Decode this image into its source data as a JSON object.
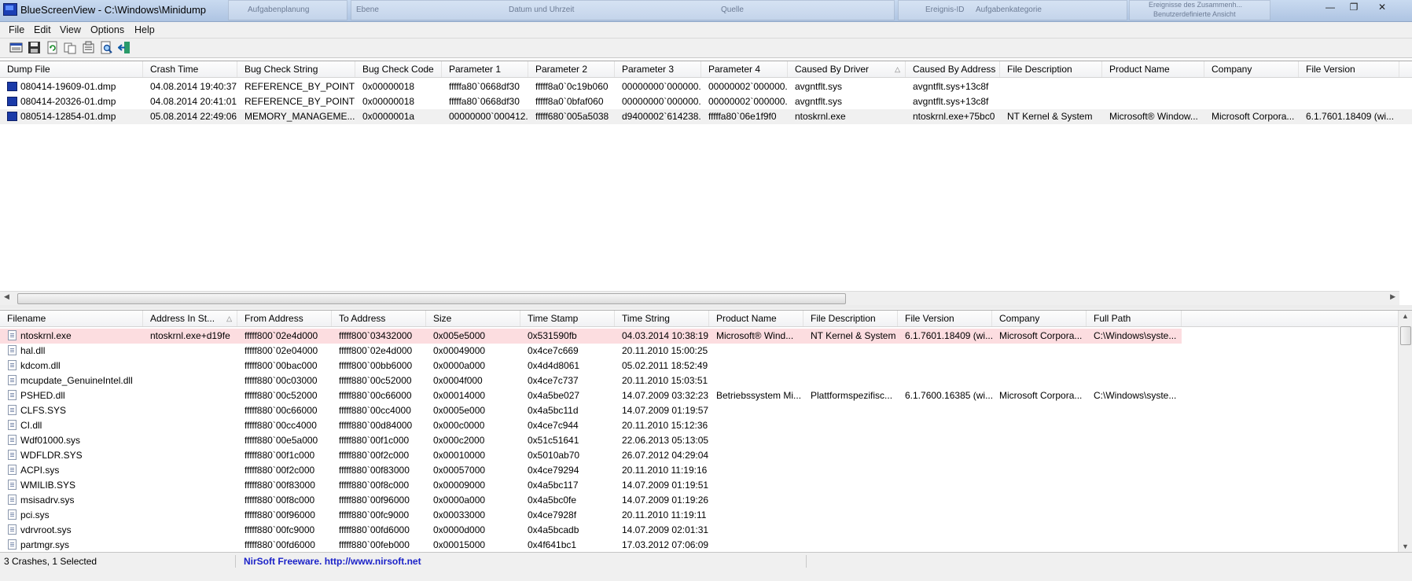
{
  "window": {
    "title": "BlueScreenView  -  C:\\Windows\\Minidump",
    "background_ghosts": [
      "Aufgabenplanung",
      "Ebene",
      "Datum und Uhrzeit",
      "Quelle",
      "Ereignis-ID",
      "Aufgabenkategorie",
      "Ereignisse des Zusammenh...",
      "Benutzerdefinierte Ansicht"
    ]
  },
  "menu": {
    "items": [
      "File",
      "Edit",
      "View",
      "Options",
      "Help"
    ]
  },
  "toolbar": {
    "buttons": [
      "properties-icon",
      "save-icon",
      "refresh-icon",
      "copy-icon",
      "options-icon",
      "find-icon",
      "exit-icon"
    ]
  },
  "crash_list": {
    "columns": [
      "Dump File",
      "Crash Time",
      "Bug Check String",
      "Bug Check Code",
      "Parameter 1",
      "Parameter 2",
      "Parameter 3",
      "Parameter 4",
      "Caused By Driver",
      "Caused By Address",
      "File Description",
      "Product Name",
      "Company",
      "File Version"
    ],
    "rows": [
      [
        "080414-19609-01.dmp",
        "04.08.2014 19:40:37",
        "REFERENCE_BY_POINTER",
        "0x00000018",
        "fffffa80`0668df30",
        "fffff8a0`0c19b060",
        "00000000`000000...",
        "00000002`000000...",
        "avgntflt.sys",
        "avgntflt.sys+13c8f",
        "",
        "",
        "",
        ""
      ],
      [
        "080414-20326-01.dmp",
        "04.08.2014 20:41:01",
        "REFERENCE_BY_POINTER",
        "0x00000018",
        "fffffa80`0668df30",
        "fffff8a0`0bfaf060",
        "00000000`000000...",
        "00000002`000000...",
        "avgntflt.sys",
        "avgntflt.sys+13c8f",
        "",
        "",
        "",
        ""
      ],
      [
        "080514-12854-01.dmp",
        "05.08.2014 22:49:06",
        "MEMORY_MANAGEME...",
        "0x0000001a",
        "00000000`000412...",
        "fffff680`005a5038",
        "d9400002`614238...",
        "fffffa80`06e1f9f0",
        "ntoskrnl.exe",
        "ntoskrnl.exe+75bc0",
        "NT Kernel & System",
        "Microsoft® Window...",
        "Microsoft Corpora...",
        "6.1.7601.18409 (wi..."
      ]
    ]
  },
  "module_list": {
    "columns": [
      "Filename",
      "Address In St...",
      "From Address",
      "To Address",
      "Size",
      "Time Stamp",
      "Time String",
      "Product Name",
      "File Description",
      "File Version",
      "Company",
      "Full Path"
    ],
    "rows": [
      [
        "ntoskrnl.exe",
        "ntoskrnl.exe+d19fe",
        "fffff800`02e4d000",
        "fffff800`03432000",
        "0x005e5000",
        "0x531590fb",
        "04.03.2014 10:38:19",
        "Microsoft® Wind...",
        "NT Kernel & System",
        "6.1.7601.18409 (wi...",
        "Microsoft Corpora...",
        "C:\\Windows\\syste..."
      ],
      [
        "hal.dll",
        "",
        "fffff800`02e04000",
        "fffff800`02e4d000",
        "0x00049000",
        "0x4ce7c669",
        "20.11.2010 15:00:25",
        "",
        "",
        "",
        "",
        ""
      ],
      [
        "kdcom.dll",
        "",
        "fffff800`00bac000",
        "fffff800`00bb6000",
        "0x0000a000",
        "0x4d4d8061",
        "05.02.2011 18:52:49",
        "",
        "",
        "",
        "",
        ""
      ],
      [
        "mcupdate_GenuineIntel.dll",
        "",
        "fffff880`00c03000",
        "fffff880`00c52000",
        "0x0004f000",
        "0x4ce7c737",
        "20.11.2010 15:03:51",
        "",
        "",
        "",
        "",
        ""
      ],
      [
        "PSHED.dll",
        "",
        "fffff880`00c52000",
        "fffff880`00c66000",
        "0x00014000",
        "0x4a5be027",
        "14.07.2009 03:32:23",
        "Betriebssystem Mi...",
        "Plattformspezifisc...",
        "6.1.7600.16385 (wi...",
        "Microsoft Corpora...",
        "C:\\Windows\\syste..."
      ],
      [
        "CLFS.SYS",
        "",
        "fffff880`00c66000",
        "fffff880`00cc4000",
        "0x0005e000",
        "0x4a5bc11d",
        "14.07.2009 01:19:57",
        "",
        "",
        "",
        "",
        ""
      ],
      [
        "CI.dll",
        "",
        "fffff880`00cc4000",
        "fffff880`00d84000",
        "0x000c0000",
        "0x4ce7c944",
        "20.11.2010 15:12:36",
        "",
        "",
        "",
        "",
        ""
      ],
      [
        "Wdf01000.sys",
        "",
        "fffff880`00e5a000",
        "fffff880`00f1c000",
        "0x000c2000",
        "0x51c51641",
        "22.06.2013 05:13:05",
        "",
        "",
        "",
        "",
        ""
      ],
      [
        "WDFLDR.SYS",
        "",
        "fffff880`00f1c000",
        "fffff880`00f2c000",
        "0x00010000",
        "0x5010ab70",
        "26.07.2012 04:29:04",
        "",
        "",
        "",
        "",
        ""
      ],
      [
        "ACPI.sys",
        "",
        "fffff880`00f2c000",
        "fffff880`00f83000",
        "0x00057000",
        "0x4ce79294",
        "20.11.2010 11:19:16",
        "",
        "",
        "",
        "",
        ""
      ],
      [
        "WMILIB.SYS",
        "",
        "fffff880`00f83000",
        "fffff880`00f8c000",
        "0x00009000",
        "0x4a5bc117",
        "14.07.2009 01:19:51",
        "",
        "",
        "",
        "",
        ""
      ],
      [
        "msisadrv.sys",
        "",
        "fffff880`00f8c000",
        "fffff880`00f96000",
        "0x0000a000",
        "0x4a5bc0fe",
        "14.07.2009 01:19:26",
        "",
        "",
        "",
        "",
        ""
      ],
      [
        "pci.sys",
        "",
        "fffff880`00f96000",
        "fffff880`00fc9000",
        "0x00033000",
        "0x4ce7928f",
        "20.11.2010 11:19:11",
        "",
        "",
        "",
        "",
        ""
      ],
      [
        "vdrvroot.sys",
        "",
        "fffff880`00fc9000",
        "fffff880`00fd6000",
        "0x0000d000",
        "0x4a5bcadb",
        "14.07.2009 02:01:31",
        "",
        "",
        "",
        "",
        ""
      ],
      [
        "partmgr.sys",
        "",
        "fffff880`00fd6000",
        "fffff880`00feb000",
        "0x00015000",
        "0x4f641bc1",
        "17.03.2012 07:06:09",
        "",
        "",
        "",
        "",
        ""
      ]
    ]
  },
  "statusbar": {
    "count": "3 Crashes, 1 Selected",
    "credit": "NirSoft Freeware.  http://www.nirsoft.net"
  }
}
